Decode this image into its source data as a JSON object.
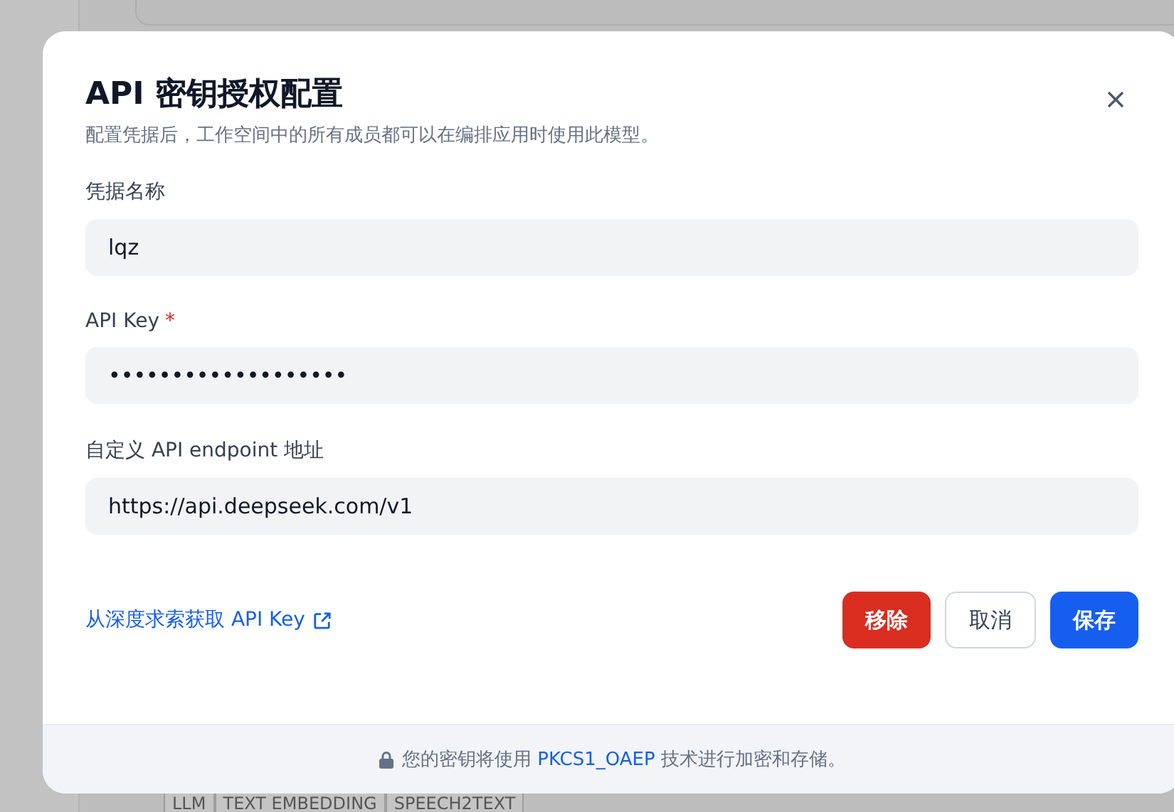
{
  "background": {
    "tags": [
      "LLM",
      "TEXT EMBEDDING",
      "SPEECH2TEXT"
    ]
  },
  "dialog": {
    "title": "API 密钥授权配置",
    "subtitle": "配置凭据后，工作空间中的所有成员都可以在编排应用时使用此模型。",
    "fields": [
      {
        "label": "凭据名称",
        "value": "lqz"
      },
      {
        "label": "API Key",
        "required_mark": "*",
        "value": "•••••••••••••••••••"
      },
      {
        "label": "自定义 API endpoint 地址",
        "value": "https://api.deepseek.com/v1"
      }
    ],
    "link": "从深度求索获取 API Key",
    "buttons": [
      {
        "label": "移除",
        "kind": "danger"
      },
      {
        "label": "取消",
        "kind": "secondary"
      },
      {
        "label": "保存",
        "kind": "primary"
      }
    ],
    "footer": {
      "before": "您的密钥将使用",
      "link": "PKCS1_OAEP",
      "after": "技术进行加密和存储。"
    }
  }
}
